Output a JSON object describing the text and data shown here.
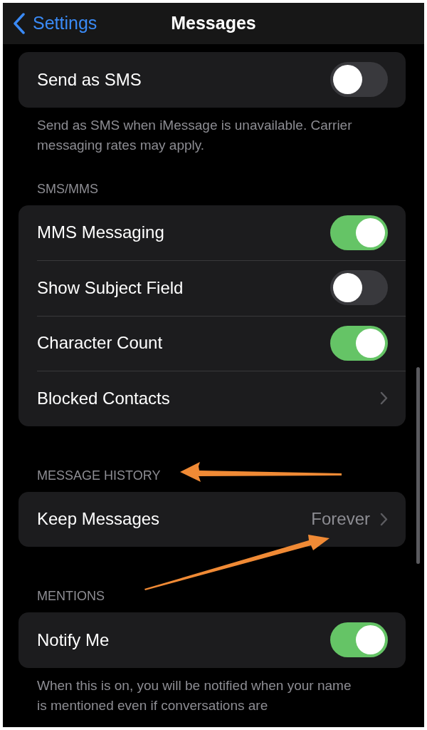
{
  "nav": {
    "back_label": "Settings",
    "title": "Messages"
  },
  "sections": [
    {
      "rows": [
        {
          "kind": "toggle",
          "label": "Send as SMS",
          "on": false
        }
      ],
      "footer": "Send as SMS when iMessage is unavailable. Carrier messaging rates may apply."
    },
    {
      "header": "SMS/MMS",
      "rows": [
        {
          "kind": "toggle",
          "label": "MMS Messaging",
          "on": true
        },
        {
          "kind": "toggle",
          "label": "Show Subject Field",
          "on": false
        },
        {
          "kind": "toggle",
          "label": "Character Count",
          "on": true
        },
        {
          "kind": "link",
          "label": "Blocked Contacts"
        }
      ]
    },
    {
      "header": "MESSAGE HISTORY",
      "rows": [
        {
          "kind": "link",
          "label": "Keep Messages",
          "value": "Forever"
        }
      ]
    },
    {
      "header": "MENTIONS",
      "rows": [
        {
          "kind": "toggle",
          "label": "Notify Me",
          "on": true
        }
      ],
      "footer": "When this is on, you will be notified when your name is mentioned even if conversations are"
    }
  ]
}
